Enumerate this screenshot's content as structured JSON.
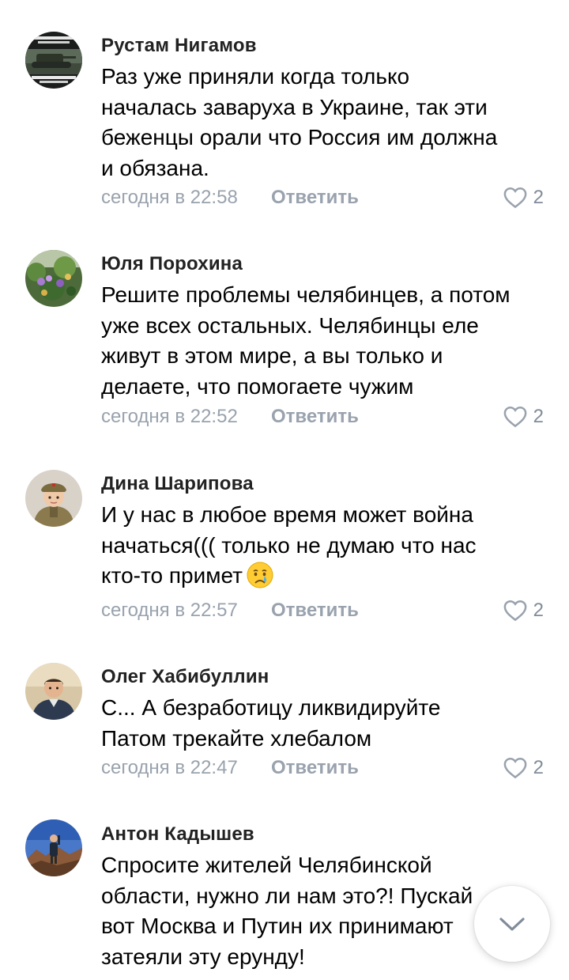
{
  "comments": [
    {
      "author": "Рустам Нигамов",
      "lines": [
        "Раз уже приняли когда только",
        "началась заваруха в Украине, так эти",
        "беженцы орали что Россия им должна",
        "и обязана."
      ],
      "time": "сегодня в 22:58",
      "reply": "Ответить",
      "likes": "2",
      "avatar_icon": "tank-meme-avatar"
    },
    {
      "author": "Юля Порохина",
      "lines": [
        "Решите проблемы челябинцев, а потом",
        "уже всех остальных. Челябинцы еле",
        "живут в этом мире, а вы только и",
        "делаете, что помогаете чужим"
      ],
      "time": "сегодня в 22:52",
      "reply": "Ответить",
      "likes": "2",
      "avatar_icon": "flowers-avatar"
    },
    {
      "author": "Дина Шарипова",
      "lines": [
        "И у нас в любое время  может  война",
        "начаться((( только  не думаю что нас",
        "кто-то  примет"
      ],
      "emoji": "crying-face-emoji",
      "time": "сегодня в 22:57",
      "reply": "Ответить",
      "likes": "2",
      "avatar_icon": "child-in-uniform-avatar"
    },
    {
      "author": "Олег Хабибуллин",
      "lines": [
        "С... А безработицу ликвидируйте",
        "Патом трекайте хлебалом"
      ],
      "time": "сегодня в 22:47",
      "reply": "Ответить",
      "likes": "2",
      "avatar_icon": "man-portrait-avatar"
    },
    {
      "author": "Антон Кадышев",
      "lines": [
        "Спросите жителей Челябинской",
        "области, нужно ли нам это?! Пускай",
        "вот Москва и Путин их принимают",
        "затеяли эту ерунду!"
      ],
      "avatar_icon": "mountain-photo-avatar"
    }
  ],
  "scroll_button_icon": "chevron-down-icon",
  "colors": {
    "meta": "#99a2ad",
    "text": "#000000",
    "author": "#222222",
    "like_icon": "#99a2ad"
  }
}
